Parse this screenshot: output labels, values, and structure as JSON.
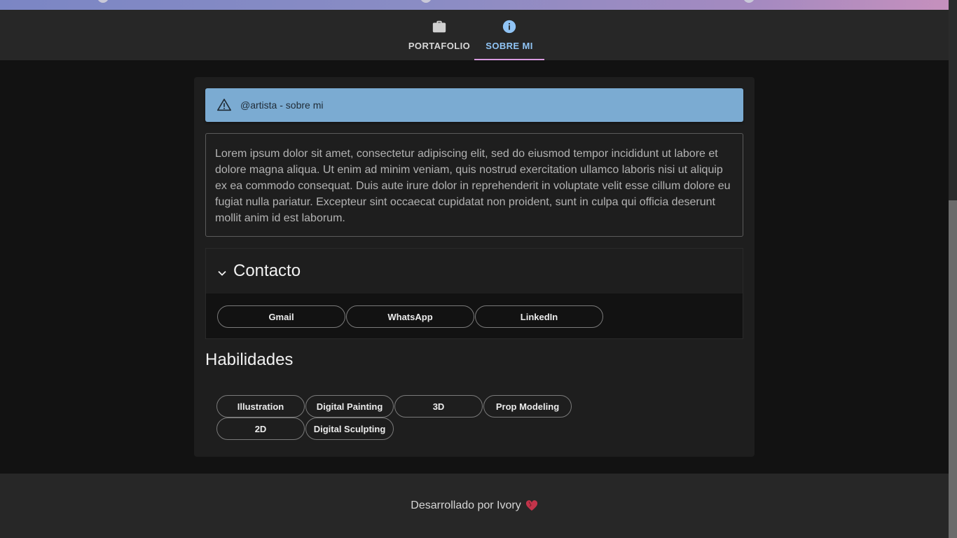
{
  "nav": {
    "tabs": [
      {
        "label": "PORTAFOLIO",
        "icon": "briefcase-icon",
        "active": false
      },
      {
        "label": "SOBRE MI",
        "icon": "info-icon",
        "active": true
      }
    ]
  },
  "alert": {
    "icon": "warning-icon",
    "text": "@artista - sobre mi"
  },
  "about": {
    "text": "Lorem ipsum dolor sit amet, consectetur adipiscing elit, sed do eiusmod tempor incididunt ut labore et dolore magna aliqua. Ut enim ad minim veniam, quis nostrud exercitation ullamco laboris nisi ut aliquip ex ea commodo consequat. Duis aute irure dolor in reprehenderit in voluptate velit esse cillum dolore eu fugiat nulla pariatur. Excepteur sint occaecat cupidatat non proident, sunt in culpa qui officia deserunt mollit anim id est laborum."
  },
  "contact": {
    "title": "Contacto",
    "buttons": [
      "Gmail",
      "WhatsApp",
      "LinkedIn"
    ]
  },
  "skills": {
    "title": "Habilidades",
    "items": [
      "Illustration",
      "Digital Painting",
      "3D",
      "Prop Modeling",
      "2D",
      "Digital Sculpting"
    ]
  },
  "footer": {
    "text": "Desarrollado por Ivory",
    "icon": "heart-icon"
  },
  "colors": {
    "accent": "#90c4f5",
    "tab_indicator": "#d89be0",
    "alert_bg": "#7babd2"
  }
}
